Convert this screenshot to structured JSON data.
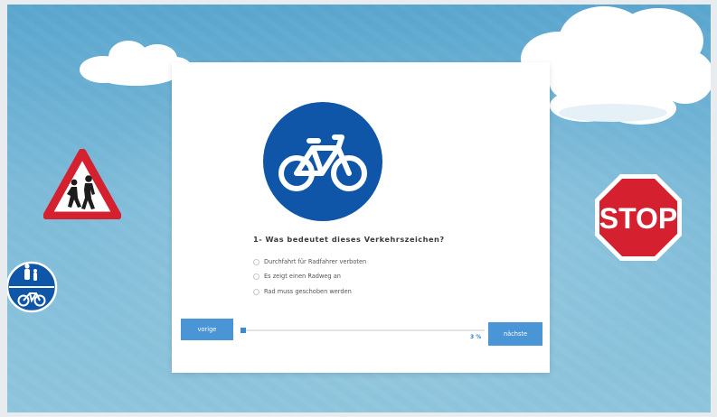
{
  "quiz": {
    "question": "1- Was bedeutet dieses Verkehrszeichen?",
    "options": [
      "Durchfahrt für Radfahrer verboten",
      "Es zeigt einen Radweg an",
      "Rad muss geschoben werden"
    ],
    "prev_label": "vorige",
    "next_label": "nächste",
    "progress_text": "3 %",
    "progress_value": 0.03
  },
  "signs": {
    "stop_text": "STOP"
  },
  "colors": {
    "sign_blue": "#0f55a8",
    "sign_red": "#d4202f",
    "button_blue": "#4a95d6"
  }
}
